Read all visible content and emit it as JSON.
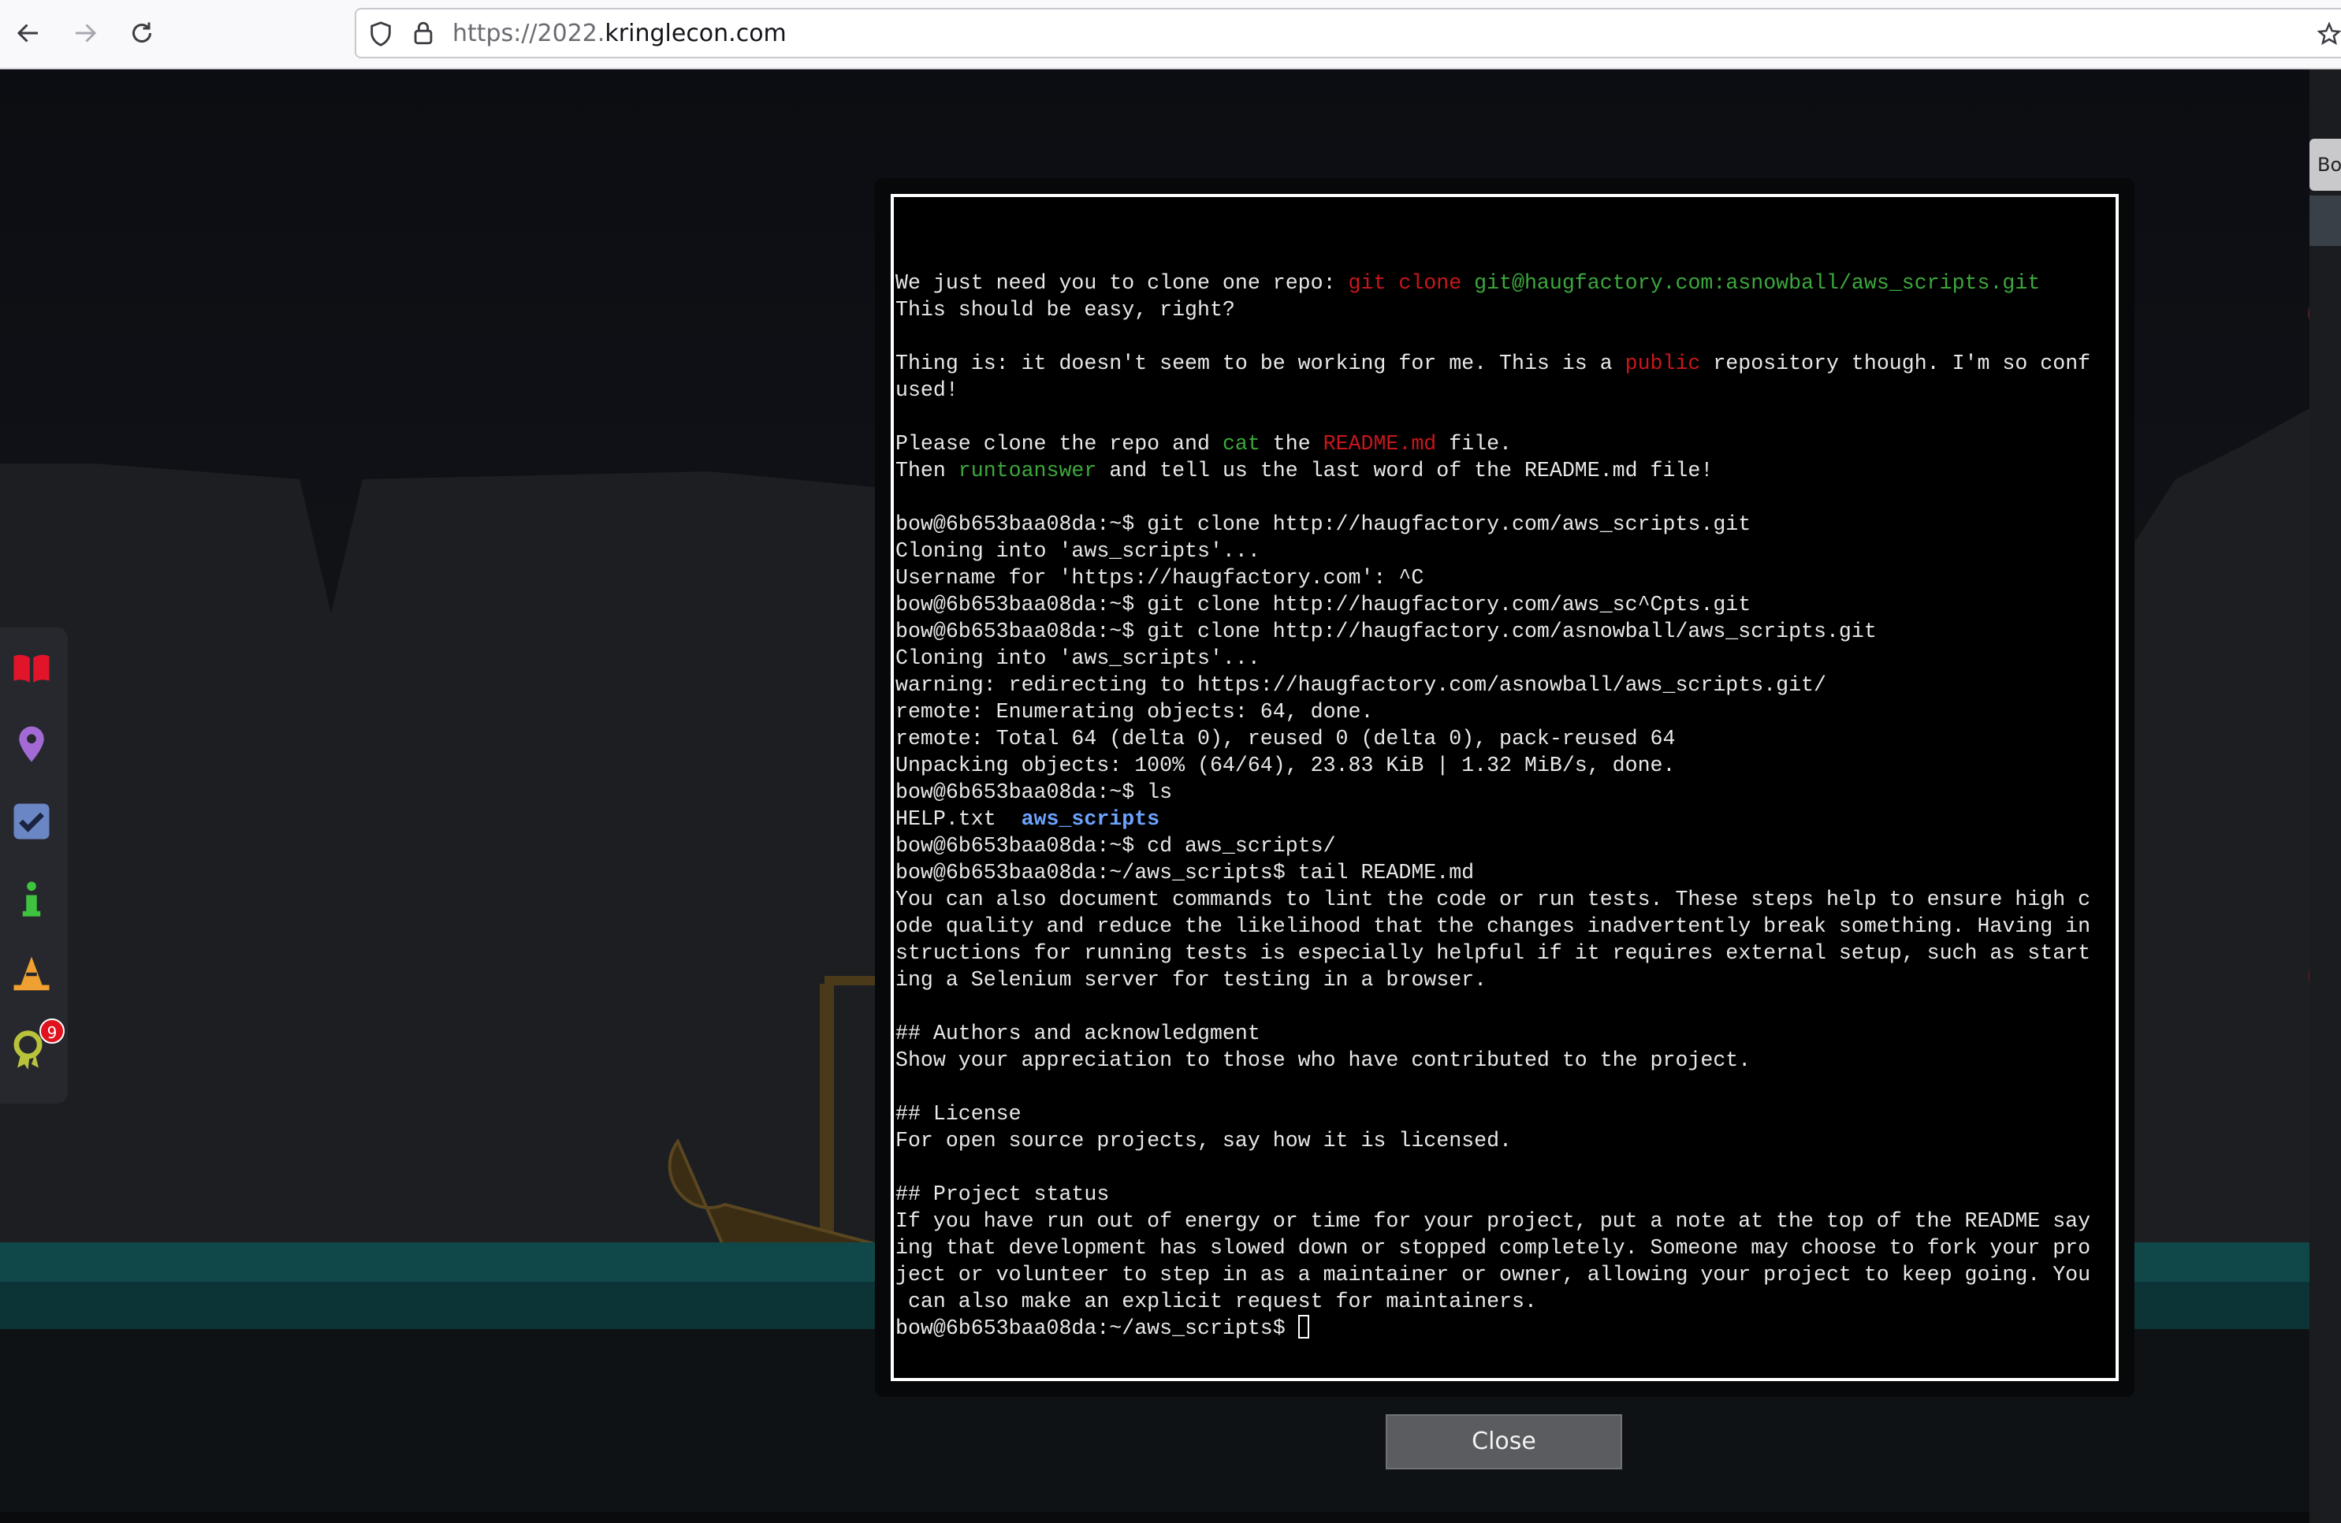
{
  "browser": {
    "url_prefix": "https://2022.",
    "url_domain": "kringlecon.com",
    "icons": [
      "back-arrow-icon",
      "forward-arrow-icon",
      "reload-icon",
      "shield-icon",
      "lock-icon",
      "star-icon"
    ]
  },
  "side_menu": {
    "items": [
      "book-icon",
      "map-pin-icon",
      "checkbox-icon",
      "info-icon",
      "hat-icon",
      "achievement-icon"
    ],
    "achievement_badge": "9"
  },
  "right_tab_label": "Bo",
  "terminal": {
    "lines": [
      [
        {
          "t": "We just need you to clone one repo: "
        },
        {
          "t": "git clone",
          "c": "r"
        },
        {
          "t": " "
        },
        {
          "t": "git@haugfactory.com:asnowball/aws_scripts.git",
          "c": "g"
        }
      ],
      [
        {
          "t": "This should be easy, right?"
        }
      ],
      [],
      [
        {
          "t": "Thing is: it doesn't seem to be working for me. This is a "
        },
        {
          "t": "public",
          "c": "r"
        },
        {
          "t": " repository though. I'm so conf"
        }
      ],
      [
        {
          "t": "used!"
        }
      ],
      [],
      [
        {
          "t": "Please clone the repo and "
        },
        {
          "t": "cat",
          "c": "g"
        },
        {
          "t": " the "
        },
        {
          "t": "README.md",
          "c": "r"
        },
        {
          "t": " file."
        }
      ],
      [
        {
          "t": "Then "
        },
        {
          "t": "runtoanswer",
          "c": "g"
        },
        {
          "t": " and tell us the last word of the README.md file!"
        }
      ],
      [],
      [
        {
          "t": "bow@6b653baa08da:~$ git clone http://haugfactory.com/aws_scripts.git"
        }
      ],
      [
        {
          "t": "Cloning into 'aws_scripts'..."
        }
      ],
      [
        {
          "t": "Username for 'https://haugfactory.com': ^C"
        }
      ],
      [
        {
          "t": "bow@6b653baa08da:~$ git clone http://haugfactory.com/aws_sc^Cpts.git"
        }
      ],
      [
        {
          "t": "bow@6b653baa08da:~$ git clone http://haugfactory.com/asnowball/aws_scripts.git"
        }
      ],
      [
        {
          "t": "Cloning into 'aws_scripts'..."
        }
      ],
      [
        {
          "t": "warning: redirecting to https://haugfactory.com/asnowball/aws_scripts.git/"
        }
      ],
      [
        {
          "t": "remote: Enumerating objects: 64, done."
        }
      ],
      [
        {
          "t": "remote: Total 64 (delta 0), reused 0 (delta 0), pack-reused 64"
        }
      ],
      [
        {
          "t": "Unpacking objects: 100% (64/64), 23.83 KiB | 1.32 MiB/s, done."
        }
      ],
      [
        {
          "t": "bow@6b653baa08da:~$ ls"
        }
      ],
      [
        {
          "t": "HELP.txt  "
        },
        {
          "t": "aws_scripts",
          "c": "b"
        }
      ],
      [
        {
          "t": "bow@6b653baa08da:~$ cd aws_scripts/"
        }
      ],
      [
        {
          "t": "bow@6b653baa08da:~/aws_scripts$ tail README.md"
        }
      ],
      [
        {
          "t": "You can also document commands to lint the code or run tests. These steps help to ensure high c"
        }
      ],
      [
        {
          "t": "ode quality and reduce the likelihood that the changes inadvertently break something. Having in"
        }
      ],
      [
        {
          "t": "structions for running tests is especially helpful if it requires external setup, such as start"
        }
      ],
      [
        {
          "t": "ing a Selenium server for testing in a browser."
        }
      ],
      [],
      [
        {
          "t": "## Authors and acknowledgment"
        }
      ],
      [
        {
          "t": "Show your appreciation to those who have contributed to the project."
        }
      ],
      [],
      [
        {
          "t": "## License"
        }
      ],
      [
        {
          "t": "For open source projects, say how it is licensed."
        }
      ],
      [],
      [
        {
          "t": "## Project status"
        }
      ],
      [
        {
          "t": "If you have run out of energy or time for your project, put a note at the top of the README say"
        }
      ],
      [
        {
          "t": "ing that development has slowed down or stopped completely. Someone may choose to fork your pro"
        }
      ],
      [
        {
          "t": "ject or volunteer to step in as a maintainer or owner, allowing your project to keep going. You"
        }
      ],
      [
        {
          "t": " can also make an explicit request for maintainers."
        }
      ]
    ],
    "prompt": "bow@6b653baa08da:~/aws_scripts$ "
  },
  "close_label": "Close"
}
